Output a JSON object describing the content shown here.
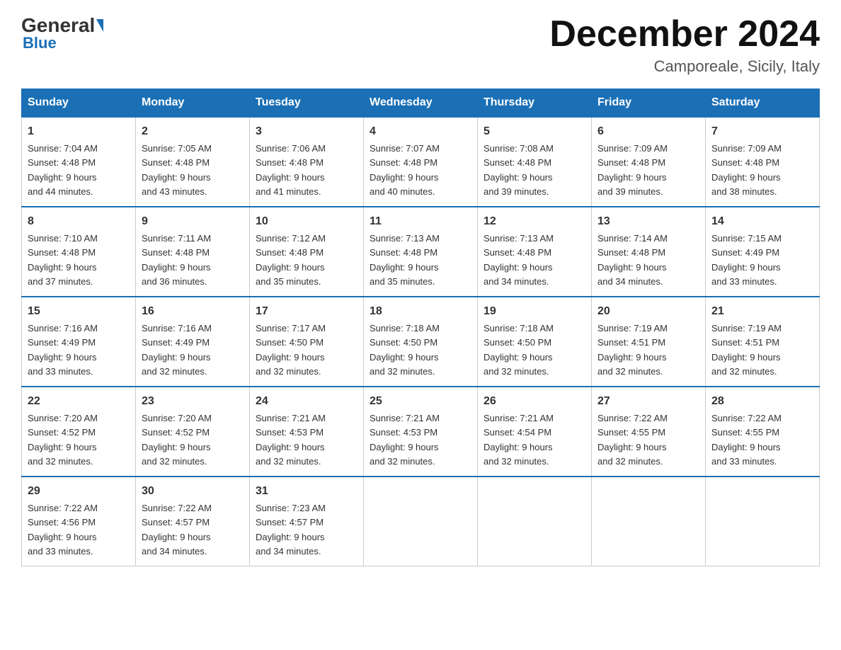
{
  "header": {
    "logo_general": "General",
    "logo_blue": "Blue",
    "month_title": "December 2024",
    "location": "Camporeale, Sicily, Italy"
  },
  "days_of_week": [
    "Sunday",
    "Monday",
    "Tuesday",
    "Wednesday",
    "Thursday",
    "Friday",
    "Saturday"
  ],
  "weeks": [
    [
      {
        "num": "1",
        "sunrise": "7:04 AM",
        "sunset": "4:48 PM",
        "daylight": "9 hours and 44 minutes."
      },
      {
        "num": "2",
        "sunrise": "7:05 AM",
        "sunset": "4:48 PM",
        "daylight": "9 hours and 43 minutes."
      },
      {
        "num": "3",
        "sunrise": "7:06 AM",
        "sunset": "4:48 PM",
        "daylight": "9 hours and 41 minutes."
      },
      {
        "num": "4",
        "sunrise": "7:07 AM",
        "sunset": "4:48 PM",
        "daylight": "9 hours and 40 minutes."
      },
      {
        "num": "5",
        "sunrise": "7:08 AM",
        "sunset": "4:48 PM",
        "daylight": "9 hours and 39 minutes."
      },
      {
        "num": "6",
        "sunrise": "7:09 AM",
        "sunset": "4:48 PM",
        "daylight": "9 hours and 39 minutes."
      },
      {
        "num": "7",
        "sunrise": "7:09 AM",
        "sunset": "4:48 PM",
        "daylight": "9 hours and 38 minutes."
      }
    ],
    [
      {
        "num": "8",
        "sunrise": "7:10 AM",
        "sunset": "4:48 PM",
        "daylight": "9 hours and 37 minutes."
      },
      {
        "num": "9",
        "sunrise": "7:11 AM",
        "sunset": "4:48 PM",
        "daylight": "9 hours and 36 minutes."
      },
      {
        "num": "10",
        "sunrise": "7:12 AM",
        "sunset": "4:48 PM",
        "daylight": "9 hours and 35 minutes."
      },
      {
        "num": "11",
        "sunrise": "7:13 AM",
        "sunset": "4:48 PM",
        "daylight": "9 hours and 35 minutes."
      },
      {
        "num": "12",
        "sunrise": "7:13 AM",
        "sunset": "4:48 PM",
        "daylight": "9 hours and 34 minutes."
      },
      {
        "num": "13",
        "sunrise": "7:14 AM",
        "sunset": "4:48 PM",
        "daylight": "9 hours and 34 minutes."
      },
      {
        "num": "14",
        "sunrise": "7:15 AM",
        "sunset": "4:49 PM",
        "daylight": "9 hours and 33 minutes."
      }
    ],
    [
      {
        "num": "15",
        "sunrise": "7:16 AM",
        "sunset": "4:49 PM",
        "daylight": "9 hours and 33 minutes."
      },
      {
        "num": "16",
        "sunrise": "7:16 AM",
        "sunset": "4:49 PM",
        "daylight": "9 hours and 32 minutes."
      },
      {
        "num": "17",
        "sunrise": "7:17 AM",
        "sunset": "4:50 PM",
        "daylight": "9 hours and 32 minutes."
      },
      {
        "num": "18",
        "sunrise": "7:18 AM",
        "sunset": "4:50 PM",
        "daylight": "9 hours and 32 minutes."
      },
      {
        "num": "19",
        "sunrise": "7:18 AM",
        "sunset": "4:50 PM",
        "daylight": "9 hours and 32 minutes."
      },
      {
        "num": "20",
        "sunrise": "7:19 AM",
        "sunset": "4:51 PM",
        "daylight": "9 hours and 32 minutes."
      },
      {
        "num": "21",
        "sunrise": "7:19 AM",
        "sunset": "4:51 PM",
        "daylight": "9 hours and 32 minutes."
      }
    ],
    [
      {
        "num": "22",
        "sunrise": "7:20 AM",
        "sunset": "4:52 PM",
        "daylight": "9 hours and 32 minutes."
      },
      {
        "num": "23",
        "sunrise": "7:20 AM",
        "sunset": "4:52 PM",
        "daylight": "9 hours and 32 minutes."
      },
      {
        "num": "24",
        "sunrise": "7:21 AM",
        "sunset": "4:53 PM",
        "daylight": "9 hours and 32 minutes."
      },
      {
        "num": "25",
        "sunrise": "7:21 AM",
        "sunset": "4:53 PM",
        "daylight": "9 hours and 32 minutes."
      },
      {
        "num": "26",
        "sunrise": "7:21 AM",
        "sunset": "4:54 PM",
        "daylight": "9 hours and 32 minutes."
      },
      {
        "num": "27",
        "sunrise": "7:22 AM",
        "sunset": "4:55 PM",
        "daylight": "9 hours and 32 minutes."
      },
      {
        "num": "28",
        "sunrise": "7:22 AM",
        "sunset": "4:55 PM",
        "daylight": "9 hours and 33 minutes."
      }
    ],
    [
      {
        "num": "29",
        "sunrise": "7:22 AM",
        "sunset": "4:56 PM",
        "daylight": "9 hours and 33 minutes."
      },
      {
        "num": "30",
        "sunrise": "7:22 AM",
        "sunset": "4:57 PM",
        "daylight": "9 hours and 34 minutes."
      },
      {
        "num": "31",
        "sunrise": "7:23 AM",
        "sunset": "4:57 PM",
        "daylight": "9 hours and 34 minutes."
      },
      null,
      null,
      null,
      null
    ]
  ],
  "labels": {
    "sunrise": "Sunrise:",
    "sunset": "Sunset:",
    "daylight": "Daylight:"
  }
}
